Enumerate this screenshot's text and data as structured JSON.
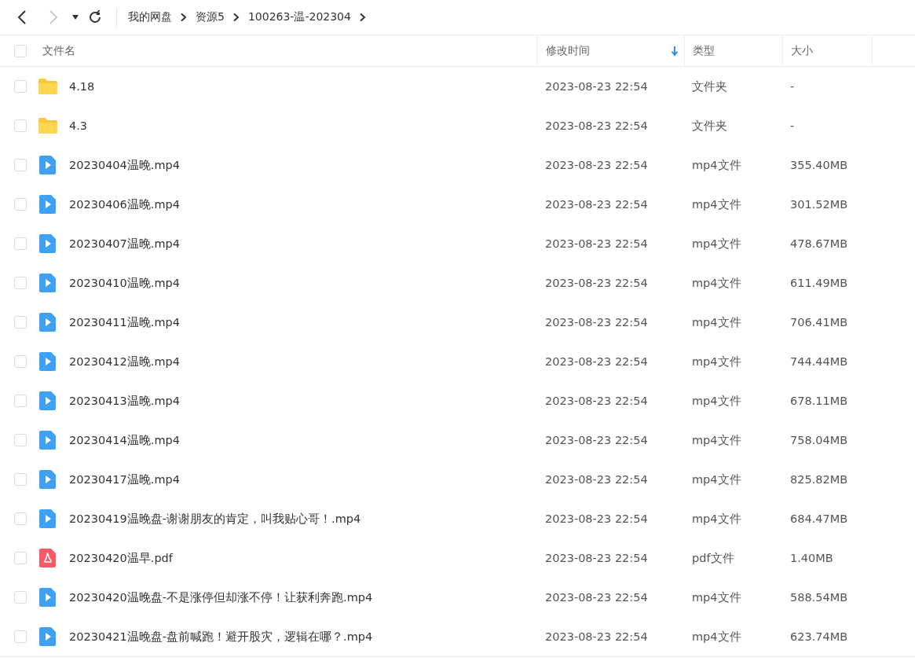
{
  "toolbar": {
    "breadcrumbs": [
      "我的网盘",
      "资源5",
      "100263-温-202304"
    ]
  },
  "table": {
    "select_all": {
      "checked": false
    },
    "columns": [
      {
        "label": "文件名",
        "sorted": false
      },
      {
        "label": "修改时间",
        "sorted": true
      },
      {
        "label": "类型",
        "sorted": false
      },
      {
        "label": "大小",
        "sorted": false
      }
    ],
    "rows": [
      {
        "kind": "folder",
        "name": "4.18",
        "modified": "2023-08-23 22:54",
        "type": "文件夹",
        "size": "-",
        "checked": false
      },
      {
        "kind": "folder",
        "name": "4.3",
        "modified": "2023-08-23 22:54",
        "type": "文件夹",
        "size": "-",
        "checked": false
      },
      {
        "kind": "video",
        "name": "20230404温晚.mp4",
        "modified": "2023-08-23 22:54",
        "type": "mp4文件",
        "size": "355.40MB",
        "checked": false
      },
      {
        "kind": "video",
        "name": "20230406温晚.mp4",
        "modified": "2023-08-23 22:54",
        "type": "mp4文件",
        "size": "301.52MB",
        "checked": false
      },
      {
        "kind": "video",
        "name": "20230407温晚.mp4",
        "modified": "2023-08-23 22:54",
        "type": "mp4文件",
        "size": "478.67MB",
        "checked": false
      },
      {
        "kind": "video",
        "name": "20230410温晚.mp4",
        "modified": "2023-08-23 22:54",
        "type": "mp4文件",
        "size": "611.49MB",
        "checked": false
      },
      {
        "kind": "video",
        "name": "20230411温晚.mp4",
        "modified": "2023-08-23 22:54",
        "type": "mp4文件",
        "size": "706.41MB",
        "checked": false
      },
      {
        "kind": "video",
        "name": "20230412温晚.mp4",
        "modified": "2023-08-23 22:54",
        "type": "mp4文件",
        "size": "744.44MB",
        "checked": false
      },
      {
        "kind": "video",
        "name": "20230413温晚.mp4",
        "modified": "2023-08-23 22:54",
        "type": "mp4文件",
        "size": "678.11MB",
        "checked": false
      },
      {
        "kind": "video",
        "name": "20230414温晚.mp4",
        "modified": "2023-08-23 22:54",
        "type": "mp4文件",
        "size": "758.04MB",
        "checked": false
      },
      {
        "kind": "video",
        "name": "20230417温晚.mp4",
        "modified": "2023-08-23 22:54",
        "type": "mp4文件",
        "size": "825.82MB",
        "checked": false
      },
      {
        "kind": "video",
        "name": "20230419温晚盘-谢谢朋友的肯定，叫我贴心哥！.mp4",
        "modified": "2023-08-23 22:54",
        "type": "mp4文件",
        "size": "684.47MB",
        "checked": false
      },
      {
        "kind": "pdf",
        "name": "20230420温早.pdf",
        "modified": "2023-08-23 22:54",
        "type": "pdf文件",
        "size": "1.40MB",
        "checked": false
      },
      {
        "kind": "video",
        "name": "20230420温晚盘-不是涨停但却涨不停！让获利奔跑.mp4",
        "modified": "2023-08-23 22:54",
        "type": "mp4文件",
        "size": "588.54MB",
        "checked": false
      },
      {
        "kind": "video",
        "name": "20230421温晚盘-盘前喊跑！避开股灾，逻辑在哪？.mp4",
        "modified": "2023-08-23 22:54",
        "type": "mp4文件",
        "size": "623.74MB",
        "checked": false
      }
    ]
  }
}
